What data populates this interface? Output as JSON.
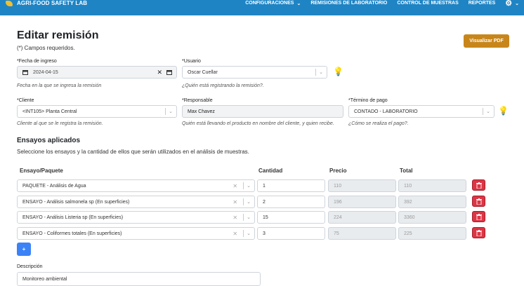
{
  "nav": {
    "brand": "AGRI-FOOD SAFETY LAB",
    "items": [
      "CONFIGURACIONES",
      "REMISIONES DE LABORATORIO",
      "CONTROL DE MUESTRAS",
      "REPORTES"
    ]
  },
  "page": {
    "title": "Editar remisión",
    "required_note": "(*) Campos requeridos.",
    "pdf_button": "Visualizar PDF"
  },
  "form": {
    "fecha": {
      "label": "*Fecha de ingreso",
      "value": "2024-04-15",
      "help": "Fecha en la que se ingresa la remisión"
    },
    "usuario": {
      "label": "*Usuario",
      "value": "Oscar Cuellar",
      "help": "¿Quién está registrando la remisión?."
    },
    "cliente": {
      "label": "*Cliente",
      "value": "<INT105> Planta Central",
      "help": "Cliente al que se le registra la remisión."
    },
    "responsable": {
      "label": "*Responsable",
      "value": "Max Chavez",
      "help": "Quién está llevando el producto en nombre del cliente, y quien recibe."
    },
    "termino": {
      "label": "*Término de pago",
      "value": "CONTADO - LABORATORIO",
      "help": "¿Cómo se realiza el pago?."
    }
  },
  "ensayos": {
    "title": "Ensayos aplicados",
    "subtitle": "Seleccione los ensayos y la cantidad de ellos que serán utilizados en el análisis de muestras.",
    "headers": {
      "ensayo": "Ensayo/Paquete",
      "cantidad": "Cantidad",
      "precio": "Precio",
      "total": "Total"
    },
    "rows": [
      {
        "ensayo": "PAQUETE - Análisis de Agua",
        "cantidad": "1",
        "precio": "110",
        "total": "110"
      },
      {
        "ensayo": "ENSAYO - Análisis salmonela sp (En superficies)",
        "cantidad": "2",
        "precio": "196",
        "total": "392"
      },
      {
        "ensayo": "ENSAYO - Análisis Listeria sp (En superficies)",
        "cantidad": "15",
        "precio": "224",
        "total": "3360"
      },
      {
        "ensayo": "ENSAYO - Coliformes totales (En superficies)",
        "cantidad": "3",
        "precio": "75",
        "total": "225"
      }
    ],
    "add_button": "+"
  },
  "descripcion": {
    "label": "Descripción",
    "value": "Monitoreo ambiental"
  }
}
